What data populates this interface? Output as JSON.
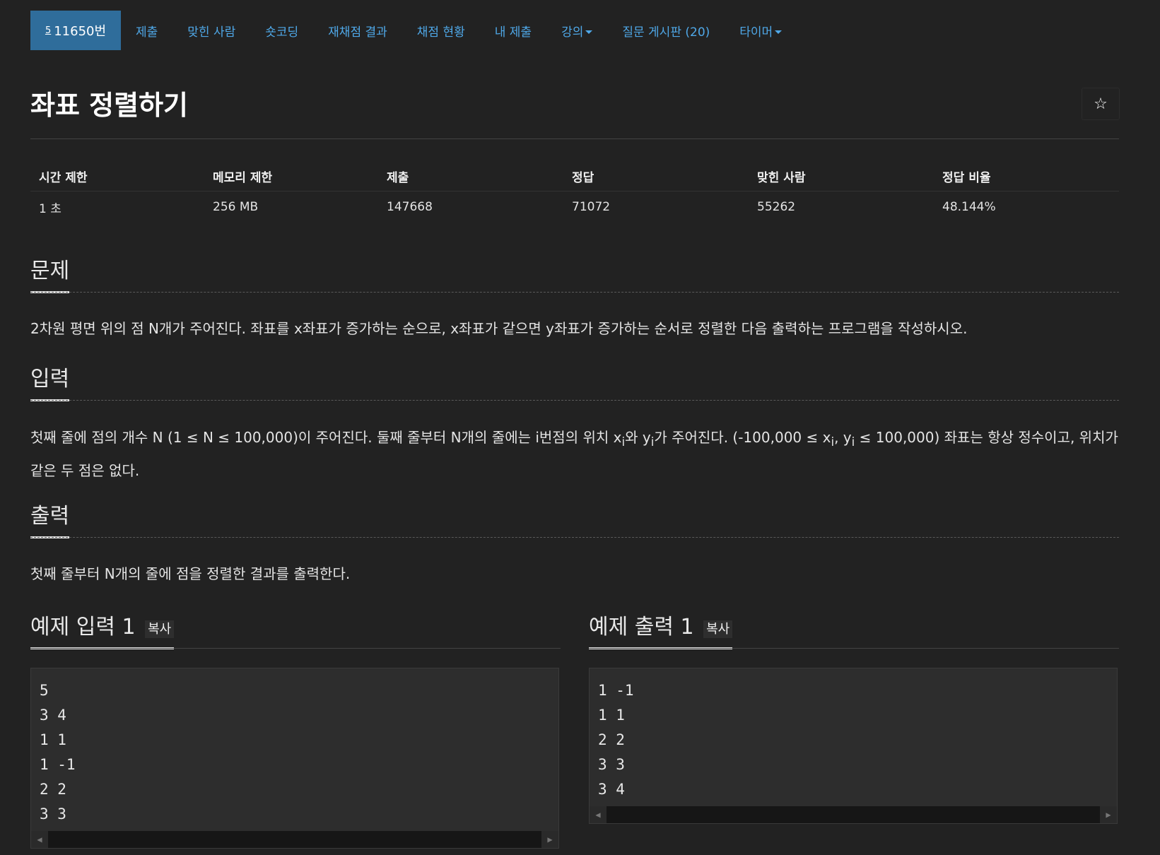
{
  "nav": {
    "active_label": "11650번",
    "active_icon": "5",
    "items": [
      "제출",
      "맞힌 사람",
      "숏코딩",
      "재채점 결과",
      "채점 현황",
      "내 제출",
      "강의",
      "질문 게시판 (20)",
      "타이머"
    ],
    "dropdown_items": [
      "강의",
      "타이머"
    ]
  },
  "title": "좌표 정렬하기",
  "star_icon": "☆",
  "info": {
    "headers": [
      "시간 제한",
      "메모리 제한",
      "제출",
      "정답",
      "맞힌 사람",
      "정답 비율"
    ],
    "values": [
      "1 초",
      "256 MB",
      "147668",
      "71072",
      "55262",
      "48.144%"
    ]
  },
  "sections": {
    "problem": {
      "heading": "문제",
      "text": "2차원 평면 위의 점 N개가 주어진다. 좌표를 x좌표가 증가하는 순으로, x좌표가 같으면 y좌표가 증가하는 순서로 정렬한 다음 출력하는 프로그램을 작성하시오."
    },
    "input": {
      "heading": "입력",
      "text_a": "첫째 줄에 점의 개수 N (1 ≤ N ≤ 100,000)이 주어진다. 둘째 줄부터 N개의 줄에는 i번점의 위치 x",
      "sub_i": "i",
      "text_b": "와 y",
      "text_c": "가 주어진다. (-100,000 ≤ x",
      "text_d": ", y",
      "text_e": " ≤ 100,000) 좌표는 항상 정수이고, 위치가 같은 두 점은 없다."
    },
    "output": {
      "heading": "출력",
      "text": "첫째 줄부터 N개의 줄에 점을 정렬한 결과를 출력한다."
    }
  },
  "samples": {
    "input": {
      "heading": "예제 입력 1",
      "copy_label": "복사",
      "lines": [
        "5",
        "3 4",
        "1 1",
        "1 -1",
        "2 2",
        "3 3"
      ]
    },
    "output": {
      "heading": "예제 출력 1",
      "copy_label": "복사",
      "lines": [
        "1 -1",
        "1 1",
        "2 2",
        "3 3",
        "3 4"
      ]
    }
  }
}
